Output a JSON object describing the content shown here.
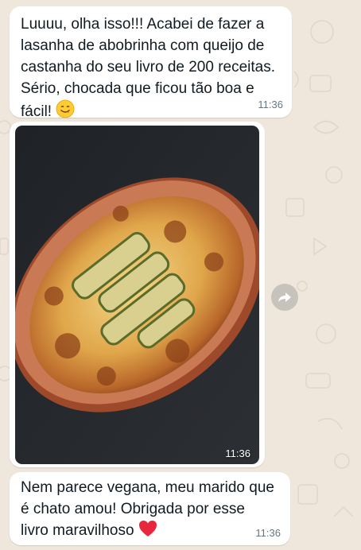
{
  "chat": {
    "background_color": "#efe7dc",
    "bubble_color": "#ffffff",
    "messages": [
      {
        "text": "Luuuu, olha isso!!! Acabei de fazer a\nlasanha de abobrinha com queijo de\ncastanha do seu livro de 200 receitas.\nSério, chocada que ficou tão boa e\nfácil!",
        "emoji": "smiling-face-savoring-food",
        "time": "11:36"
      },
      {
        "type": "image",
        "image_subject": "zucchini-lasagna-photo",
        "time": "11:36"
      },
      {
        "text": "Nem parece vegana, meu marido que\né chato amou! Obrigada por esse\nlivro maravilhoso",
        "emoji": "red-heart",
        "time": "11:36"
      }
    ],
    "forward_icon": "forward-arrow-icon"
  }
}
